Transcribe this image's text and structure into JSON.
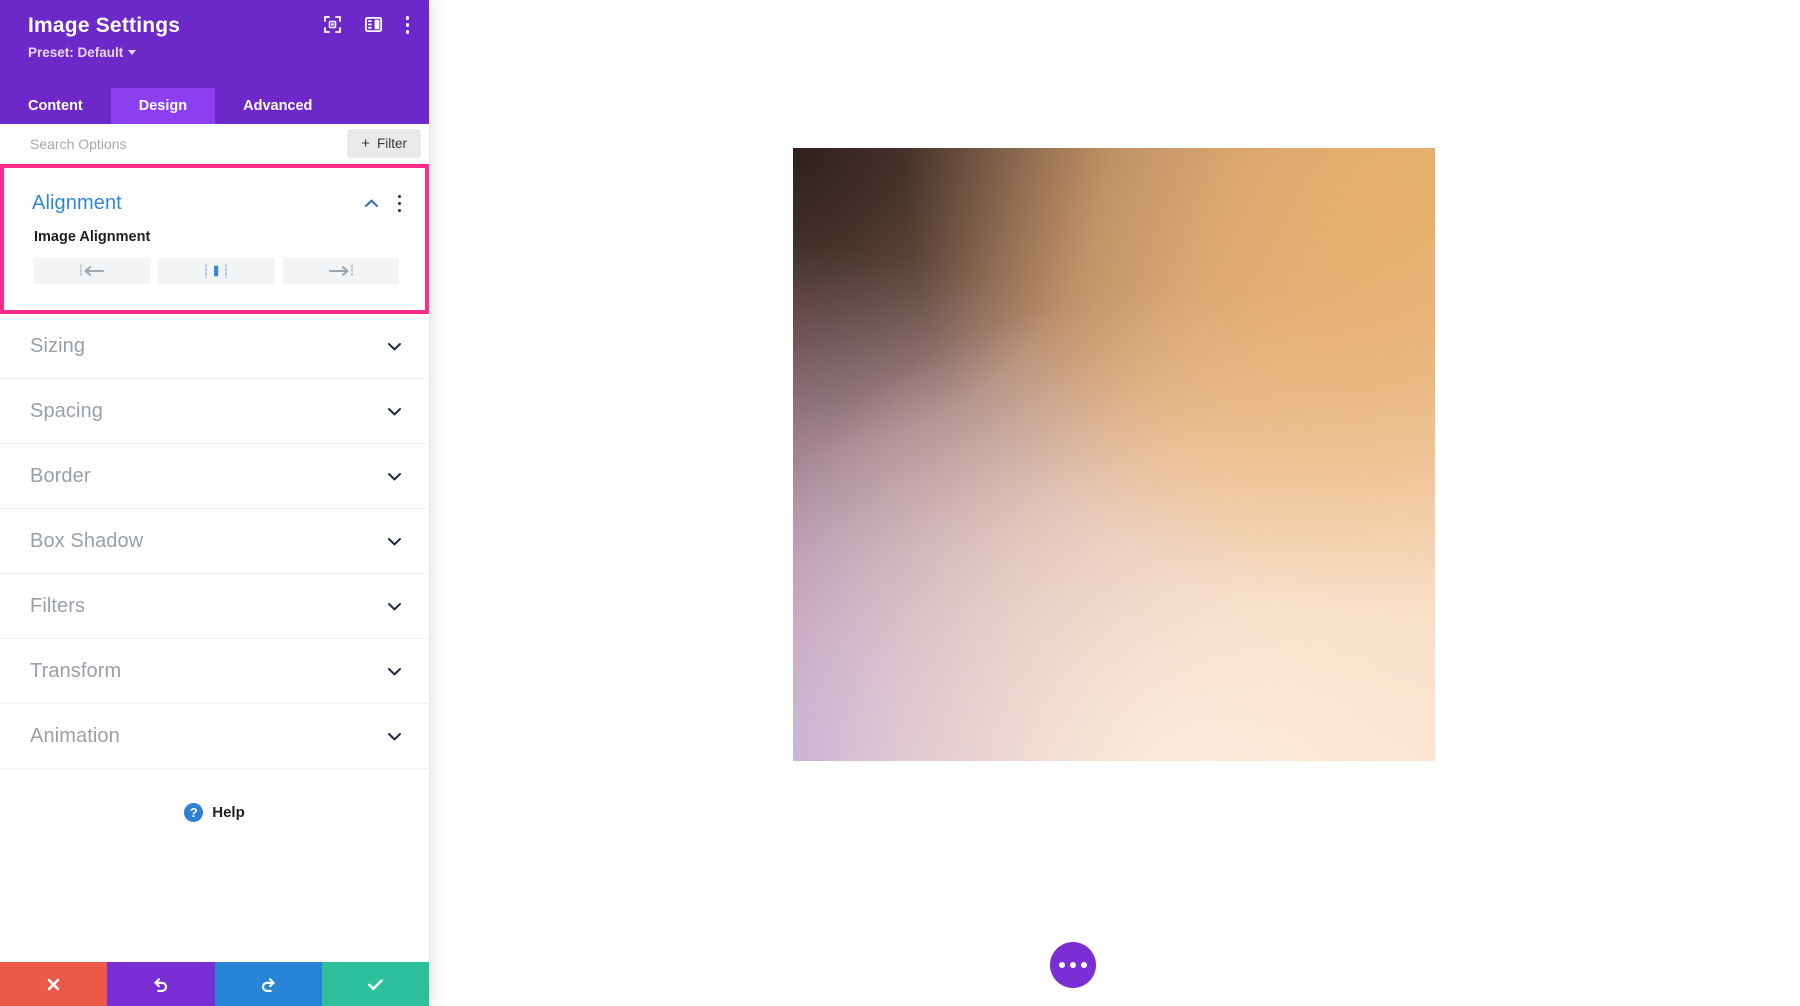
{
  "panel": {
    "title": "Image Settings",
    "preset_label": "Preset: Default",
    "header_icons": [
      {
        "name": "focus-target-icon",
        "label": "Focus"
      },
      {
        "name": "layout-panel-icon",
        "label": "Layout"
      },
      {
        "name": "more-vertical-icon",
        "label": "More Options"
      }
    ],
    "tabs": [
      {
        "label": "Content",
        "active": false
      },
      {
        "label": "Design",
        "active": true
      },
      {
        "label": "Advanced",
        "active": false
      }
    ],
    "search": {
      "placeholder": "Search Options",
      "value": ""
    },
    "filter_button": {
      "label": "Filter",
      "plus": "+"
    },
    "alignment_group": {
      "title": "Alignment",
      "title_color": "#2f87d4",
      "highlight_color": "#ff2d87",
      "expanded": true,
      "field_label": "Image Alignment",
      "options": [
        {
          "name": "align-left",
          "label": "Left",
          "selected": false
        },
        {
          "name": "align-center",
          "label": "Center",
          "selected": true
        },
        {
          "name": "align-right",
          "label": "Right",
          "selected": false
        }
      ],
      "active_color": "#3b86d8"
    },
    "sections": [
      {
        "label": "Sizing"
      },
      {
        "label": "Spacing"
      },
      {
        "label": "Border"
      },
      {
        "label": "Box Shadow"
      },
      {
        "label": "Filters"
      },
      {
        "label": "Transform"
      },
      {
        "label": "Animation"
      }
    ],
    "help": {
      "label": "Help",
      "glyph": "?"
    },
    "bottom_bar": [
      {
        "name": "cancel-button",
        "label": "Cancel",
        "color": "#eb5a49"
      },
      {
        "name": "undo-button",
        "label": "Undo",
        "color": "#7a2fd4"
      },
      {
        "name": "redo-button",
        "label": "Redo",
        "color": "#2785d8"
      },
      {
        "name": "save-button",
        "label": "Save",
        "color": "#2ec09c"
      }
    ],
    "accent_purple": "#6d28c9",
    "tab_active_purple": "#8b3ff0"
  },
  "canvas": {
    "image_alt": "Gradient image module",
    "fab": {
      "name": "module-actions-button",
      "label": "Module Actions"
    }
  }
}
